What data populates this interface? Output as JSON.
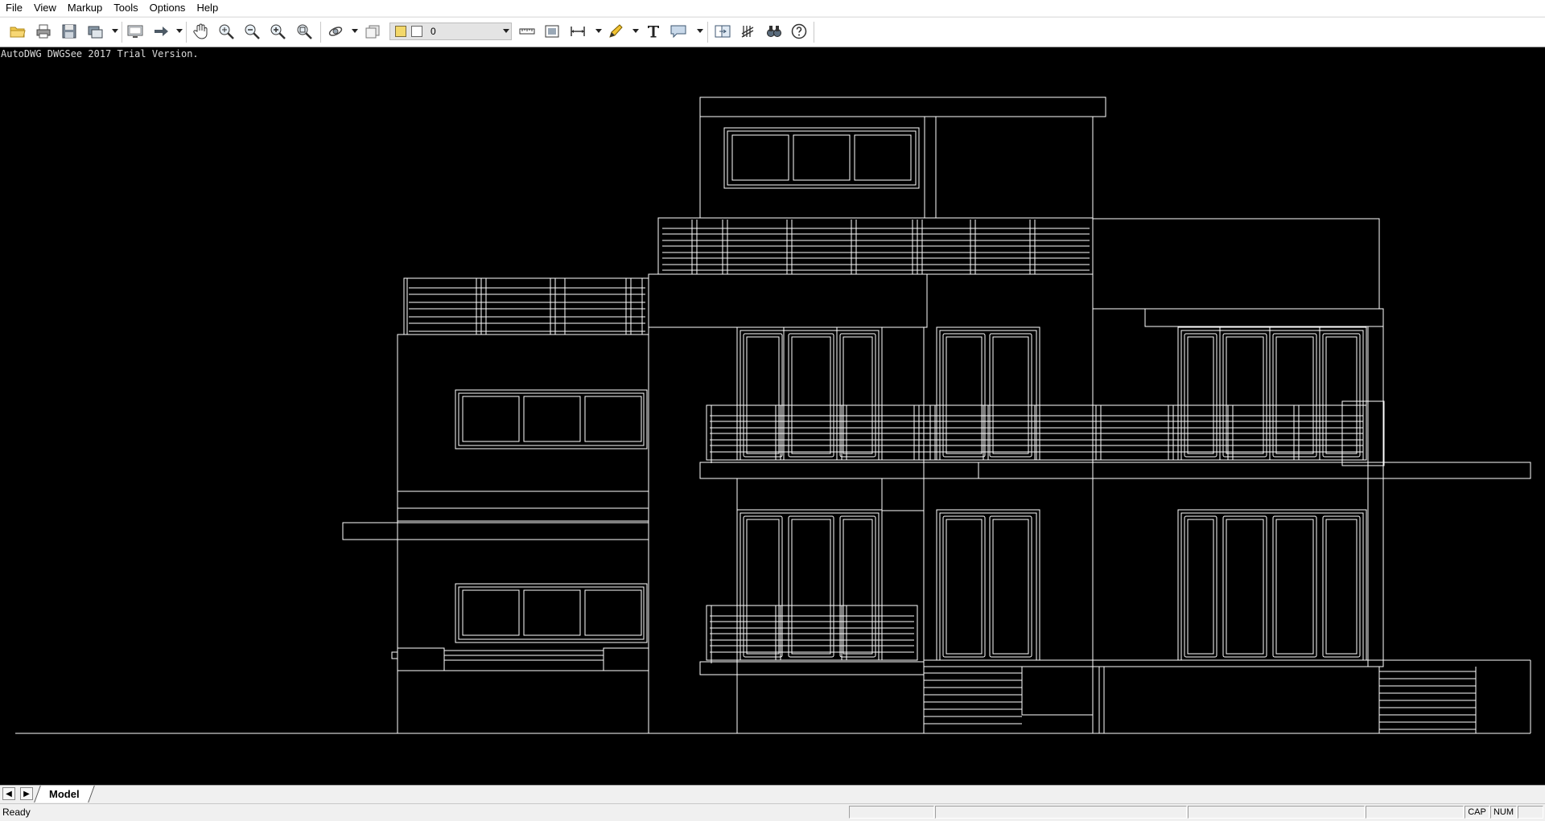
{
  "menu": [
    "File",
    "View",
    "Markup",
    "Tools",
    "Options",
    "Help"
  ],
  "toolbar": {
    "tools": [
      {
        "icon": "open-folder-icon",
        "tooltip": "Open"
      },
      {
        "icon": "print-icon",
        "tooltip": "Print"
      },
      {
        "icon": "save-icon",
        "tooltip": "Save"
      },
      {
        "icon": "batch-print-icon",
        "tooltip": "Batch"
      },
      {
        "icon": "monitor-icon",
        "tooltip": "Display"
      },
      {
        "icon": "arrow-icon",
        "tooltip": "Arrow"
      },
      {
        "icon": "pan-hand-icon",
        "tooltip": "Pan"
      },
      {
        "icon": "zoom-realtime-icon",
        "tooltip": "Zoom"
      },
      {
        "icon": "zoom-out-icon",
        "tooltip": "Zoom Out"
      },
      {
        "icon": "zoom-in-icon",
        "tooltip": "Zoom In"
      },
      {
        "icon": "zoom-extents-icon",
        "tooltip": "Zoom Extents"
      },
      {
        "icon": "orbit-icon",
        "tooltip": "Orbit"
      },
      {
        "icon": "layers-icon",
        "tooltip": "Layers"
      },
      {
        "icon": "measure-icon",
        "tooltip": "Measure"
      },
      {
        "icon": "area-icon",
        "tooltip": "Area"
      },
      {
        "icon": "dimension-icon",
        "tooltip": "Dimension"
      },
      {
        "icon": "pen-icon",
        "tooltip": "Pen"
      },
      {
        "icon": "text-icon",
        "tooltip": "Text"
      },
      {
        "icon": "callout-icon",
        "tooltip": "Callout"
      },
      {
        "icon": "compare-icon",
        "tooltip": "Compare"
      },
      {
        "icon": "hatch-icon",
        "tooltip": "Hatch"
      },
      {
        "icon": "find-icon",
        "tooltip": "Find"
      },
      {
        "icon": "help-icon",
        "tooltip": "Help"
      }
    ],
    "layer_value": "0"
  },
  "canvas": {
    "trial_notice": "AutoDWG DWGSee 2017 Trial Version.",
    "background": "#000000",
    "line_color": "#ffffff"
  },
  "tabs": {
    "active": "Model"
  },
  "status": {
    "text": "Ready",
    "caps": "CAP",
    "num": "NUM"
  }
}
